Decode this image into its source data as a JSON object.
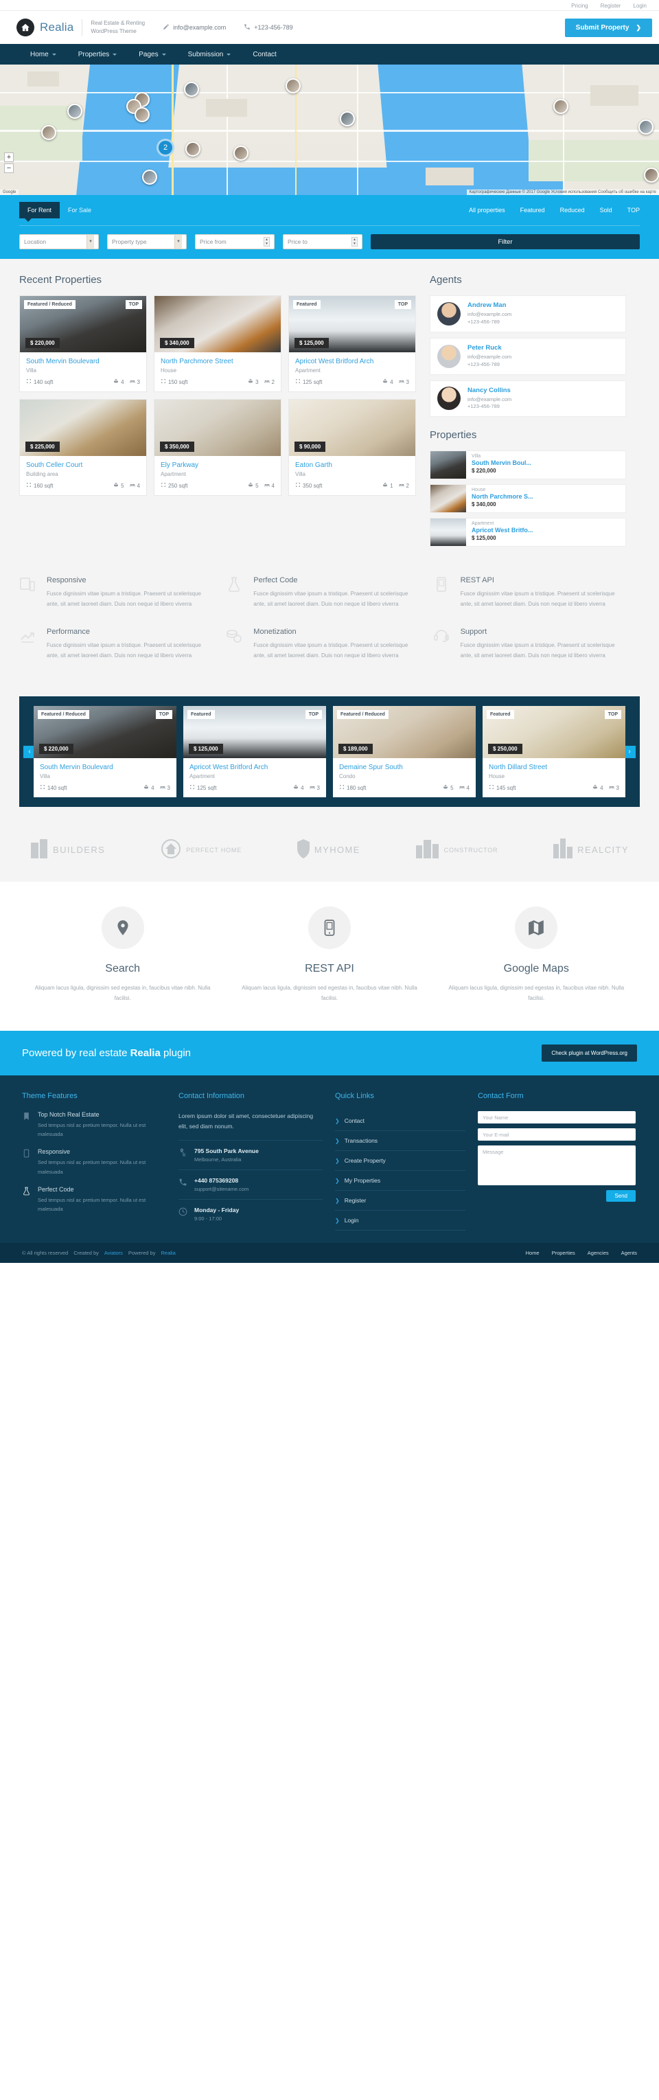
{
  "topbar": {
    "links": [
      "Pricing",
      "Register",
      "Login"
    ]
  },
  "header": {
    "brand": "Realia",
    "tagline_line1": "Real Estate & Renting",
    "tagline_line2": "WordPress Theme",
    "email": "info@example.com",
    "phone": "+123-456-789",
    "submit_label": "Submit Property",
    "submit_chevron": "❯"
  },
  "nav": {
    "items": [
      "Home",
      "Properties",
      "Pages",
      "Submission",
      "Contact"
    ]
  },
  "map": {
    "cluster_count": "2",
    "zoom_in": "+",
    "zoom_out": "−",
    "attribution_right": "Картографические Данные © 2017 Google    Условия использования    Сообщить об ошибке на карте",
    "attribution_left": "Google"
  },
  "filter": {
    "tabs": [
      {
        "label": "For Rent",
        "active": true
      },
      {
        "label": "For Sale",
        "active": false
      }
    ],
    "links": [
      "All properties",
      "Featured",
      "Reduced",
      "Sold",
      "TOP"
    ],
    "location_placeholder": "Location",
    "type_placeholder": "Property type",
    "price_from_placeholder": "Price from",
    "price_to_placeholder": "Price to",
    "button_label": "Filter"
  },
  "recent": {
    "title": "Recent Properties",
    "properties": [
      {
        "badge_left": "Featured / Reduced",
        "badge_right": "TOP",
        "price": "$ 220,000",
        "title": "South Mervin Boulevard",
        "type": "Villa",
        "area": "140 sqft",
        "baths": "4",
        "beds": "3",
        "img": "bedroom-mountain"
      },
      {
        "badge_left": "",
        "badge_right": "",
        "price": "$ 340,000",
        "title": "North Parchmore Street",
        "type": "House",
        "area": "150 sqft",
        "baths": "3",
        "beds": "2",
        "img": "kitchen"
      },
      {
        "badge_left": "Featured",
        "badge_right": "TOP",
        "price": "$ 125,000",
        "title": "Apricot West Britford Arch",
        "type": "Apartment",
        "area": "125 sqft",
        "baths": "4",
        "beds": "3",
        "img": "bedroom-white"
      },
      {
        "badge_left": "",
        "badge_right": "",
        "price": "$ 225,000",
        "title": "South Celler Court",
        "type": "Building area",
        "area": "160 sqft",
        "baths": "5",
        "beds": "4",
        "img": "living-room"
      },
      {
        "badge_left": "",
        "badge_right": "",
        "price": "$ 350,000",
        "title": "Ely Parkway",
        "type": "Apartment",
        "area": "250 sqft",
        "baths": "5",
        "beds": "4",
        "img": "sofa-room"
      },
      {
        "badge_left": "",
        "badge_right": "",
        "price": "$ 90,000",
        "title": "Eaton Garth",
        "type": "Villa",
        "area": "350 sqft",
        "baths": "1",
        "beds": "2",
        "img": "bed-window"
      }
    ]
  },
  "agents": {
    "title": "Agents",
    "list": [
      {
        "name": "Andrew Man",
        "email": "info@example.com",
        "phone": "+123-456-789"
      },
      {
        "name": "Peter Ruck",
        "email": "info@example.com",
        "phone": "+123-456-789"
      },
      {
        "name": "Nancy Collins",
        "email": "info@example.com",
        "phone": "+123-456-789"
      }
    ]
  },
  "side_properties": {
    "title": "Properties",
    "list": [
      {
        "type": "Villa",
        "title": "South Mervin Boul...",
        "price": "$ 220,000",
        "img": "bedroom-mountain"
      },
      {
        "type": "House",
        "title": "North Parchmore S...",
        "price": "$ 340,000",
        "img": "kitchen"
      },
      {
        "type": "Apartment",
        "title": "Apricot West Britfo...",
        "price": "$ 125,000",
        "img": "bedroom-white"
      }
    ]
  },
  "features": [
    {
      "icon": "responsive-icon",
      "title": "Responsive",
      "body": "Fusce dignissim vitae ipsum a tristique. Praesent ut scelerisque ante, sit amet laoreet diam. Duis non neque id libero viverra"
    },
    {
      "icon": "flask-icon",
      "title": "Perfect Code",
      "body": "Fusce dignissim vitae ipsum a tristique. Praesent ut scelerisque ante, sit amet laoreet diam. Duis non neque id libero viverra"
    },
    {
      "icon": "api-icon",
      "title": "REST API",
      "body": "Fusce dignissim vitae ipsum a tristique. Praesent ut scelerisque ante, sit amet laoreet diam. Duis non neque id libero viverra"
    },
    {
      "icon": "chart-up-icon",
      "title": "Performance",
      "body": "Fusce dignissim vitae ipsum a tristique. Praesent ut scelerisque ante, sit amet laoreet diam. Duis non neque id libero viverra"
    },
    {
      "icon": "coins-icon",
      "title": "Monetization",
      "body": "Fusce dignissim vitae ipsum a tristique. Praesent ut scelerisque ante, sit amet laoreet diam. Duis non neque id libero viverra"
    },
    {
      "icon": "support-icon",
      "title": "Support",
      "body": "Fusce dignissim vitae ipsum a tristique. Praesent ut scelerisque ante, sit amet laoreet diam. Duis non neque id libero viverra"
    }
  ],
  "carousel": {
    "prev": "‹",
    "next": "›",
    "items": [
      {
        "badge_left": "Featured / Reduced",
        "badge_right": "TOP",
        "price": "$ 220,000",
        "title": "South Mervin Boulevard",
        "type": "Villa",
        "area": "140 sqft",
        "baths": "4",
        "beds": "3",
        "img": "bedroom-mountain"
      },
      {
        "badge_left": "Featured",
        "badge_right": "TOP",
        "price": "$ 125,000",
        "title": "Apricot West Britford Arch",
        "type": "Apartment",
        "area": "125 sqft",
        "baths": "4",
        "beds": "3",
        "img": "bedroom-white"
      },
      {
        "badge_left": "Featured / Reduced",
        "badge_right": "",
        "price": "$ 189,000",
        "title": "Demaine Spur South",
        "type": "Condo",
        "area": "180 sqft",
        "baths": "5",
        "beds": "4",
        "img": "bed-lamp"
      },
      {
        "badge_left": "Featured",
        "badge_right": "TOP",
        "price": "$ 250,000",
        "title": "North Dillard Street",
        "type": "House",
        "area": "145 sqft",
        "baths": "4",
        "beds": "3",
        "img": "living-bright"
      }
    ]
  },
  "brands": [
    {
      "icon": "building-icon",
      "name": "BUILDERS",
      "style": "plain"
    },
    {
      "icon": "house-circle-icon",
      "name": "PERFECT HOME",
      "style": "small"
    },
    {
      "icon": "shield-home-icon",
      "name": "MYHOME",
      "style": "bold-my"
    },
    {
      "icon": "city-icon",
      "name": "CONSTRUCTOR",
      "style": "small"
    },
    {
      "icon": "towers-icon",
      "name": "REALCITY",
      "style": "plain"
    }
  ],
  "services": [
    {
      "icon": "map-pin-icon",
      "title": "Search",
      "body": "Aliquam lacus ligula, dignissim sed egestas in, faucibus vitae nibh. Nulla facilisi."
    },
    {
      "icon": "mobile-icon",
      "title": "REST API",
      "body": "Aliquam lacus ligula, dignissim sed egestas in, faucibus vitae nibh. Nulla facilisi."
    },
    {
      "icon": "map-icon",
      "title": "Google Maps",
      "body": "Aliquam lacus ligula, dignissim sed egestas in, faucibus vitae nibh. Nulla facilisi."
    }
  ],
  "cta": {
    "text_prefix": "Powered by real estate ",
    "text_brand": "Realia",
    "text_suffix": " plugin",
    "button": "Check plugin at WordPress.org"
  },
  "footer": {
    "col1_title": "Theme Features",
    "col1_items": [
      {
        "icon": "star-icon",
        "title": "Top Notch Real Estate",
        "body": "Sed tempus nisl ac pretium tempor. Nulla ut est malesuada"
      },
      {
        "icon": "mobile-icon",
        "title": "Responsive",
        "body": "Sed tempus nisl ac pretium tempor. Nulla ut est malesuada"
      },
      {
        "icon": "flask-icon",
        "title": "Perfect Code",
        "body": "Sed tempus nisl ac pretium tempor. Nulla ut est malesuada"
      }
    ],
    "col2_title": "Contact Information",
    "col2_intro": "Lorem ipsum dolor sit amet, consectetuer adipiscing elit, sed diam nonum.",
    "col2_items": [
      {
        "icon": "location-icon",
        "title": "795 South Park Avenue",
        "sub": "Melbourne, Australia"
      },
      {
        "icon": "phone-icon",
        "title": "+440 875369208",
        "sub": "support@sitename.com"
      },
      {
        "icon": "clock-icon",
        "title": "Monday - Friday",
        "sub": "9:00 - 17:00"
      }
    ],
    "col3_title": "Quick Links",
    "col3_links": [
      "Contact",
      "Transactions",
      "Create Property",
      "My Properties",
      "Register",
      "Login"
    ],
    "col4_title": "Contact Form",
    "name_placeholder": "Your Name",
    "email_placeholder": "Your E-mail",
    "message_placeholder": "Message",
    "send_label": "Send"
  },
  "bottombar": {
    "copyright": "© All rights reserved",
    "created_prefix": "Created by",
    "created_link": "Aviators",
    "powered_prefix": "Powered by",
    "powered_link": "Realia",
    "nav": [
      "Home",
      "Properties",
      "Agencies",
      "Agents"
    ]
  }
}
